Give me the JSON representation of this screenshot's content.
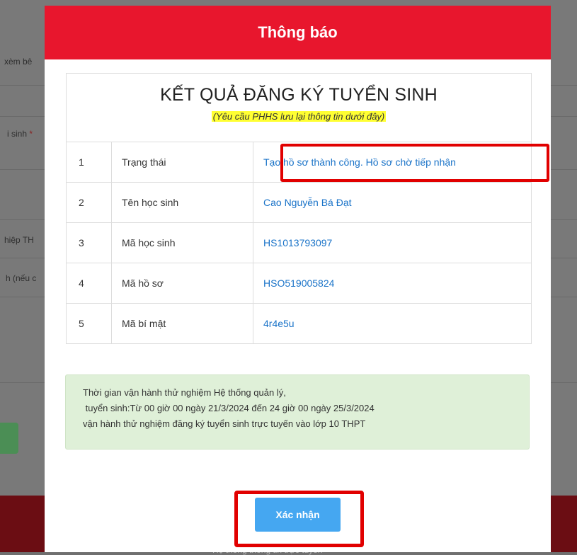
{
  "background_page": {
    "fragments": [
      "xèm bê",
      "i sinh",
      "*",
      "hiệp TH",
      "h (nếu c"
    ],
    "footer_text": "Hệ thống thông tin trực tuyến"
  },
  "modal": {
    "title": "Thông báo",
    "table_heading": "KẾT QUẢ ĐĂNG KÝ TUYỂN SINH",
    "table_note": "(Yêu cầu PHHS lưu lại thông tin dưới đây)",
    "rows": [
      {
        "no": "1",
        "label": "Trạng thái",
        "value": "Tạo hồ sơ thành công. Hồ sơ chờ tiếp nhận"
      },
      {
        "no": "2",
        "label": "Tên học sinh",
        "value": "Cao Nguyễn Bá Đạt"
      },
      {
        "no": "3",
        "label": "Mã học sinh",
        "value": "HS1013793097"
      },
      {
        "no": "4",
        "label": "Mã hồ sơ",
        "value": "HSO519005824"
      },
      {
        "no": "5",
        "label": "Mã bí mật",
        "value": "4r4e5u"
      }
    ],
    "info_lines": [
      "Thời gian vận hành thử nghiệm Hệ thống quản lý,",
      " tuyển sinh:Từ 00 giờ 00 ngày 21/3/2024 đến 24 giờ 00 ngày 25/3/2024",
      "vận hành thử nghiệm đăng ký tuyển sinh trực tuyến vào lớp 10 THPT"
    ],
    "confirm_label": "Xác nhận"
  },
  "colors": {
    "header": "#e8162d",
    "value_link": "#1a73c8",
    "info_background": "#dff0d8",
    "confirm_button": "#45a7f1",
    "highlight": "#e10000"
  }
}
